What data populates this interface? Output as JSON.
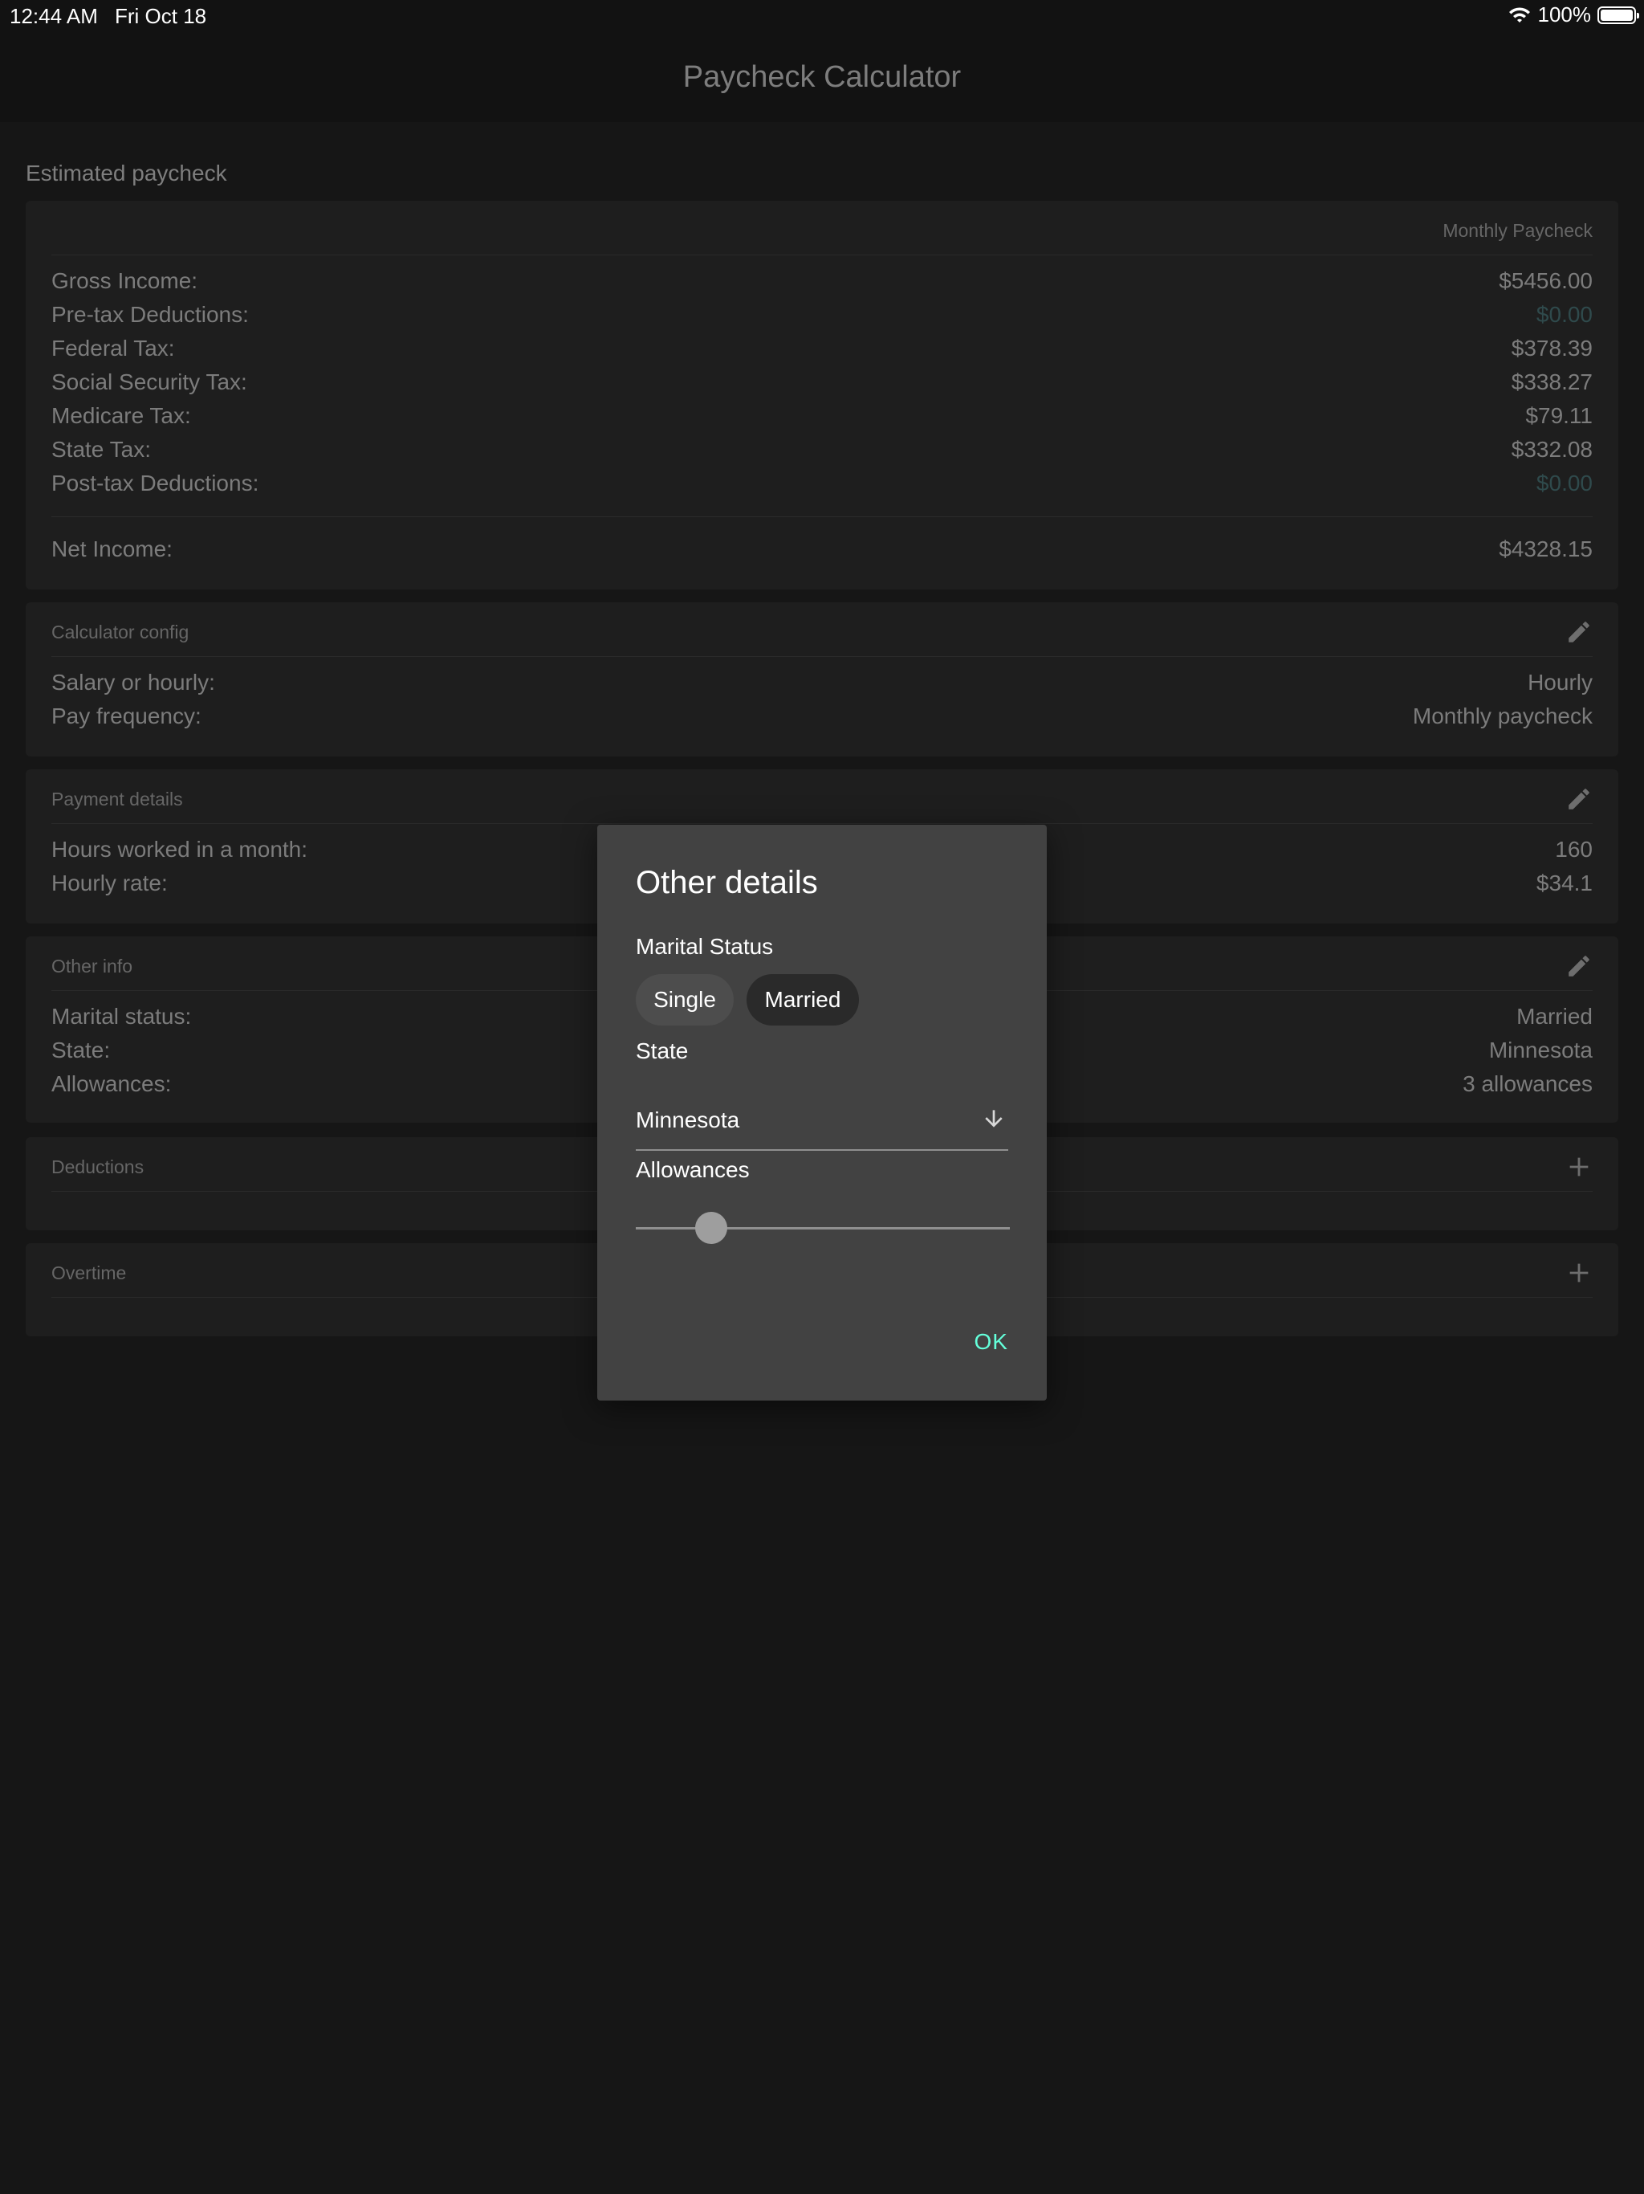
{
  "status": {
    "time": "12:44 AM",
    "date": "Fri Oct 18",
    "battery": "100%"
  },
  "nav": {
    "title": "Paycheck Calculator"
  },
  "estimated": {
    "section_label": "Estimated paycheck",
    "column_header": "Monthly Paycheck",
    "rows": [
      {
        "label": "Gross Income:",
        "value": "$5456.00",
        "dim": false
      },
      {
        "label": "Pre-tax Deductions:",
        "value": "$0.00",
        "dim": true
      },
      {
        "label": "Federal Tax:",
        "value": "$378.39",
        "dim": false
      },
      {
        "label": "Social Security Tax:",
        "value": "$338.27",
        "dim": false
      },
      {
        "label": "Medicare Tax:",
        "value": "$79.11",
        "dim": false
      },
      {
        "label": "State Tax:",
        "value": "$332.08",
        "dim": false
      },
      {
        "label": "Post-tax Deductions:",
        "value": "$0.00",
        "dim": true
      }
    ],
    "net": {
      "label": "Net Income:",
      "value": "$4328.15"
    }
  },
  "config": {
    "title": "Calculator config",
    "rows": [
      {
        "label": "Salary or hourly:",
        "value": "Hourly"
      },
      {
        "label": "Pay frequency:",
        "value": "Monthly paycheck"
      }
    ]
  },
  "payment": {
    "title": "Payment details",
    "rows": [
      {
        "label": "Hours worked in a month:",
        "value": "160"
      },
      {
        "label": "Hourly rate:",
        "value": "$34.1"
      }
    ]
  },
  "other": {
    "title": "Other info",
    "rows": [
      {
        "label": "Marital status:",
        "value": "Married"
      },
      {
        "label": "State:",
        "value": "Minnesota"
      },
      {
        "label": "Allowances:",
        "value": "3 allowances"
      }
    ]
  },
  "deductions": {
    "title": "Deductions"
  },
  "overtime": {
    "title": "Overtime"
  },
  "dialog": {
    "title": "Other details",
    "marital_label": "Marital Status",
    "chip_single": "Single",
    "chip_married": "Married",
    "selected_marital": "Married",
    "state_label": "State",
    "state_value": "Minnesota",
    "allowances_label": "Allowances",
    "allowances_fraction": 0.107,
    "ok_label": "OK"
  },
  "colors": {
    "accent": "#64ffda",
    "dialog_bg": "#424242",
    "page_bg": "#161616"
  }
}
